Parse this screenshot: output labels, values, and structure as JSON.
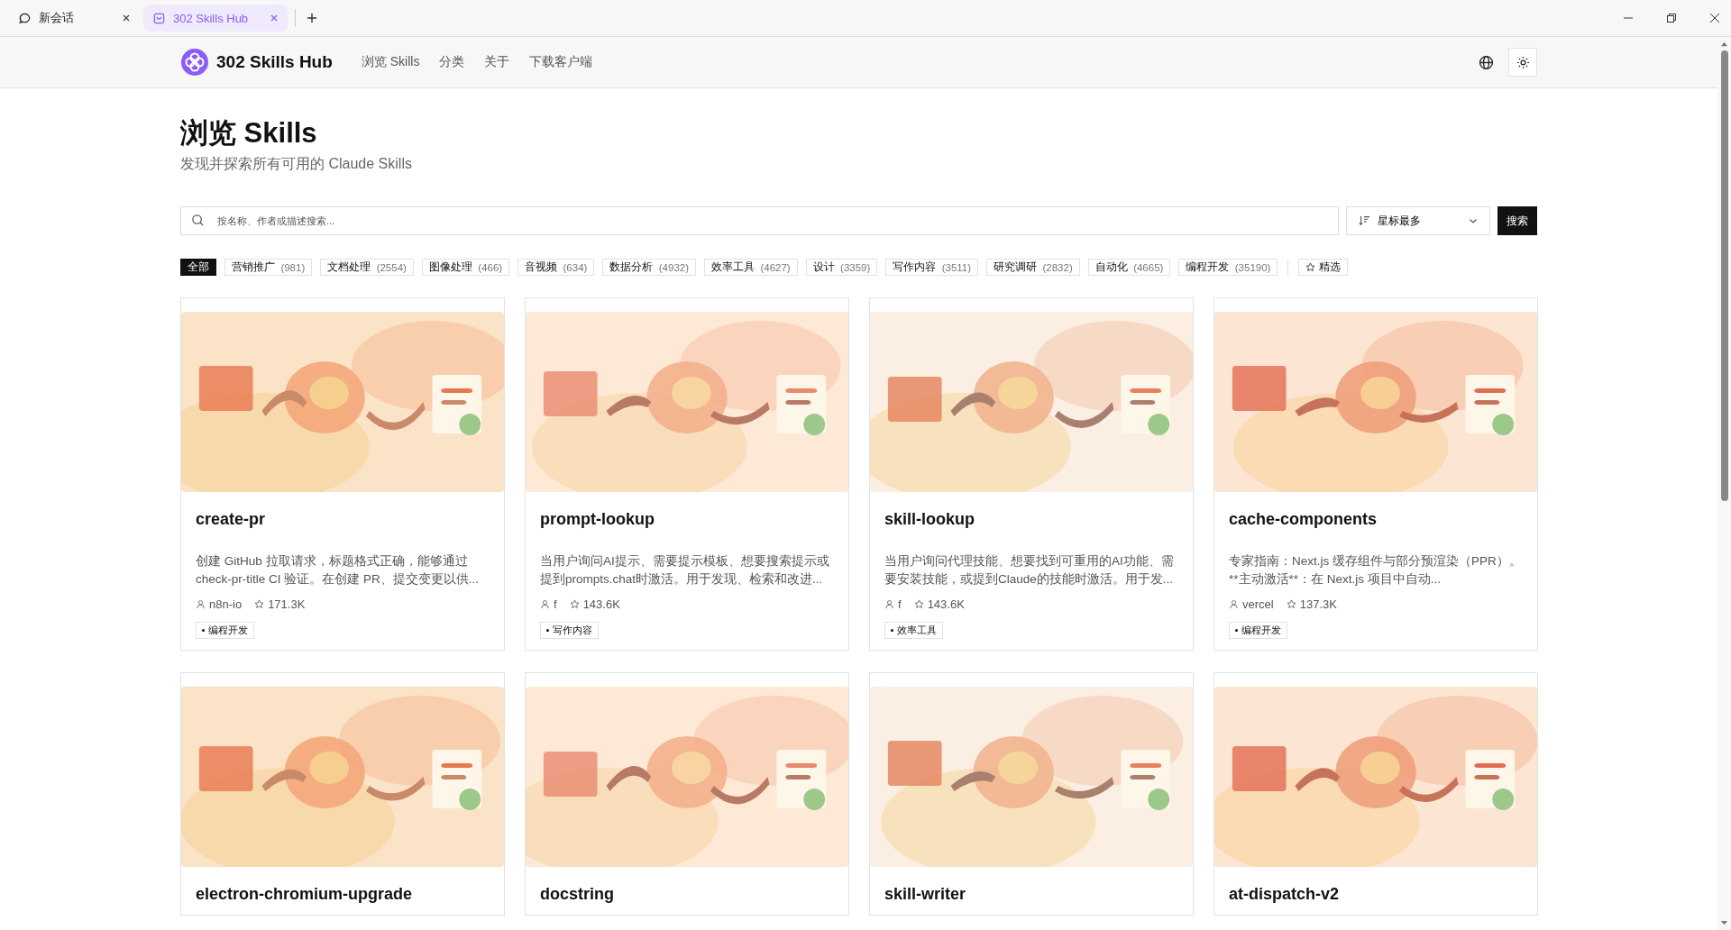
{
  "tabs": [
    {
      "label": "新会话",
      "selected": false
    },
    {
      "label": "302 Skills Hub",
      "selected": true
    }
  ],
  "header": {
    "brand": "302 Skills Hub",
    "nav": [
      "浏览 Skills",
      "分类",
      "关于",
      "下载客户端"
    ]
  },
  "page": {
    "title": "浏览 Skills",
    "subtitle": "发现并探索所有可用的 Claude Skills"
  },
  "search": {
    "placeholder": "按名称、作者或描述搜索...",
    "sort": "星标最多",
    "button": "搜索"
  },
  "filters": [
    {
      "label": "全部",
      "selected": true
    },
    {
      "label": "营销推广",
      "count": "(981)",
      "selected": false
    },
    {
      "label": "文档处理",
      "count": "(2554)",
      "selected": false
    },
    {
      "label": "图像处理",
      "count": "(466)",
      "selected": false
    },
    {
      "label": "音视频",
      "count": "(634)",
      "selected": false
    },
    {
      "label": "数据分析",
      "count": "(4932)",
      "selected": false
    },
    {
      "label": "效率工具",
      "count": "(4627)",
      "selected": false
    },
    {
      "label": "设计",
      "count": "(3359)",
      "selected": false
    },
    {
      "label": "写作内容",
      "count": "(3511)",
      "selected": false
    },
    {
      "label": "研究调研",
      "count": "(2832)",
      "selected": false
    },
    {
      "label": "自动化",
      "count": "(4665)",
      "selected": false
    },
    {
      "label": "编程开发",
      "count": "(35190)",
      "selected": false
    }
  ],
  "featured": {
    "label": "精选",
    "selected": false
  },
  "cards": [
    {
      "name": "create-pr",
      "description": "创建 GitHub 拉取请求，标题格式正确，能够通过 check-pr-title CI 验证。在创建 PR、提交变更以供...",
      "author": "n8n-io",
      "star_count": "171.3K",
      "tag": "编程开发"
    },
    {
      "name": "prompt-lookup",
      "description": "当用户询问AI提示、需要提示模板、想要搜索提示或提到prompts.chat时激活。用于发现、检索和改进...",
      "author": "f",
      "star_count": "143.6K",
      "tag": "写作内容"
    },
    {
      "name": "skill-lookup",
      "description": "当用户询问代理技能、想要找到可重用的AI功能、需要安装技能，或提到Claude的技能时激活。用于发...",
      "author": "f",
      "star_count": "143.6K",
      "tag": "效率工具"
    },
    {
      "name": "cache-components",
      "description": "专家指南：Next.js 缓存组件与部分预渲染（PPR）。**主动激活**：在 Next.js 项目中自动...",
      "author": "vercel",
      "star_count": "137.3K",
      "tag": "编程开发"
    },
    {
      "name": "electron-chromium-upgrade"
    },
    {
      "name": "docstring"
    },
    {
      "name": "skill-writer"
    },
    {
      "name": "at-dispatch-v2"
    }
  ]
}
